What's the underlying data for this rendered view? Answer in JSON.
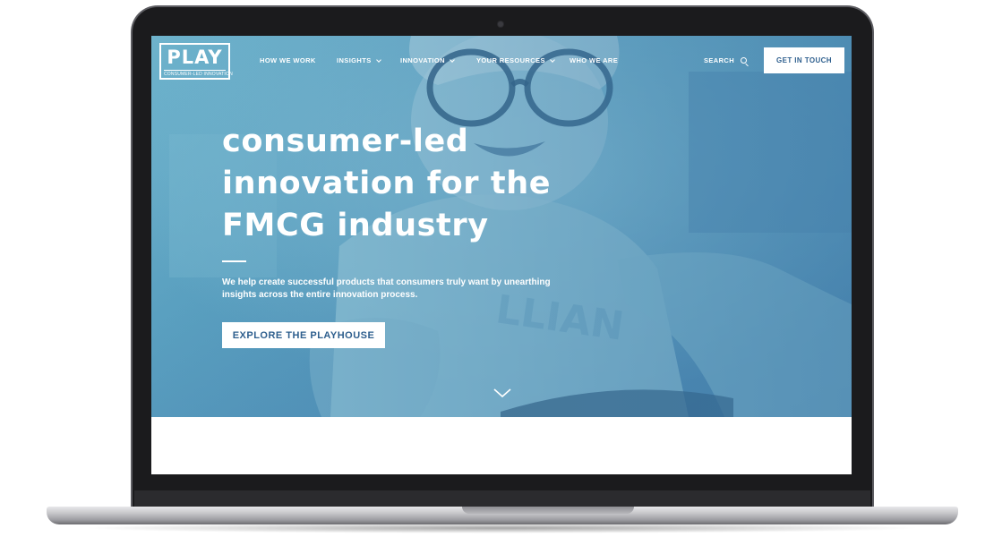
{
  "brand": {
    "logo_text": "PLAY",
    "logo_tagline": "CONSUMER-LED INNOVATION"
  },
  "nav": {
    "items": [
      {
        "label": "HOW WE WORK",
        "has_dropdown": false
      },
      {
        "label": "INSIGHTS",
        "has_dropdown": true
      },
      {
        "label": "INNOVATION",
        "has_dropdown": true
      },
      {
        "label": "YOUR RESOURCES",
        "has_dropdown": true
      },
      {
        "label": "WHO WE ARE",
        "has_dropdown": false
      }
    ],
    "search_label": "SEARCH",
    "cta_label": "GET IN TOUCH"
  },
  "hero": {
    "headline_lines": [
      "consumer-led",
      "innovation for the",
      "FMCG industry"
    ],
    "subtext_lines": [
      "We help create successful products that consumers truly want by unearthing",
      "insights across the entire innovation process."
    ],
    "cta_label": "EXPLORE THE PLAYHOUSE"
  },
  "icons": {
    "search": "search-icon",
    "dropdown": "chevron-down-icon",
    "scroll": "scroll-down-chevron-icon"
  },
  "colors": {
    "hero_tint": "#5aa0c0",
    "hero_deep": "#4b86b2",
    "button_text": "#2e5f8e",
    "laptop_bezel": "#1b1b1d"
  }
}
